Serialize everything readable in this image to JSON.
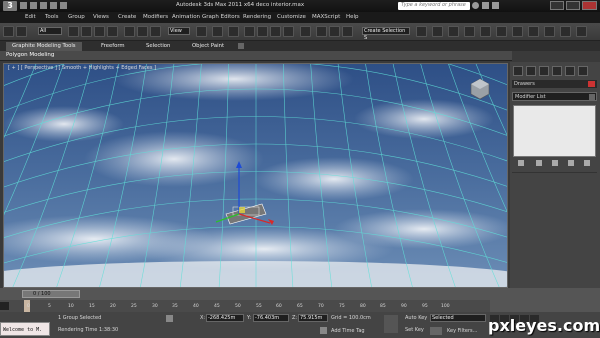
{
  "window": {
    "title": "Autodesk 3ds Max  2011 x64    deco interior.max",
    "search_placeholder": "Type a keyword or phrase"
  },
  "menu": [
    "Edit",
    "Tools",
    "Group",
    "Views",
    "Create",
    "Modifiers",
    "Animation",
    "Graph Editors",
    "Rendering",
    "Customize",
    "MAXScript",
    "Help"
  ],
  "toolbar": {
    "filter": "All",
    "ref_coord": "View",
    "selection_set": "Create Selection S"
  },
  "ribbon": {
    "tabs": [
      "Graphite Modeling Tools",
      "Freeform",
      "Selection",
      "Object Paint"
    ],
    "panel": "Polygon Modeling"
  },
  "viewport": {
    "label": "[ + ] [ Perspective ] [ Smooth + Highlights + Edged Faces ]"
  },
  "command_panel": {
    "drawers": "Drawers",
    "modifier_list": "Modifier List"
  },
  "timeline": {
    "frame": "0 / 100",
    "ticks": [
      "0",
      "5",
      "10",
      "15",
      "20",
      "25",
      "30",
      "35",
      "40",
      "45",
      "50",
      "55",
      "60",
      "65",
      "70",
      "75",
      "80",
      "85",
      "90",
      "95",
      "100"
    ]
  },
  "status": {
    "listener": "Welcome to M.",
    "selection": "1 Group Selected",
    "prompt": "Rendering Time  1:38:30",
    "x_label": "X:",
    "x": "-268.425m",
    "y_label": "Y:",
    "y": "-76.403m",
    "z_label": "Z:",
    "z": "75.915m",
    "grid": "Grid = 100.0cm",
    "add_time_tag": "Add Time Tag",
    "auto_key": "Auto Key",
    "set_key": "Set Key",
    "selected": "Selected",
    "key_filters": "Key Filters..."
  },
  "watermark": "pxleyes.com",
  "colors": {
    "grid": "#5fe0d8",
    "sky": "#3a5a8a"
  }
}
